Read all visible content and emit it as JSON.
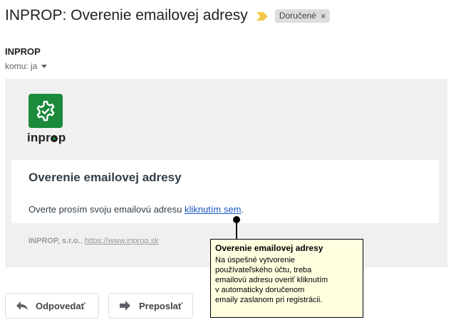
{
  "email": {
    "subject": "INPROP: Overenie emailovej adresy",
    "label": "Doručené",
    "label_remove": "×",
    "sender": "INPROP",
    "recipient": "komu: ja"
  },
  "body": {
    "logo_text_before": "inpr",
    "logo_text_after": "p",
    "card_title": "Overenie emailovej adresy",
    "card_text": "Overte prosím svoju emailovú adresu ",
    "card_link": "kliknutím sem",
    "card_text_end": ".",
    "footer_company": "INPROP, s.r.o.",
    "footer_separator": ", ",
    "footer_link": "https://www.inprop.sk"
  },
  "actions": {
    "reply": "Odpovedať",
    "forward": "Preposlať"
  },
  "callout": {
    "title": "Overenie emailovej adresy",
    "body": "Na úspešné vytvorenie\npoužívateľského účtu, treba\nemailovú adresu overiť kliknutím\nv automaticky doručenom\nemaily zaslanom pri registrácii."
  },
  "colors": {
    "brand_green": "#1b8a3a",
    "link_blue": "#1a56c4",
    "callout_bg": "#ffffe0",
    "importance_yellow": "#f2c94c"
  }
}
